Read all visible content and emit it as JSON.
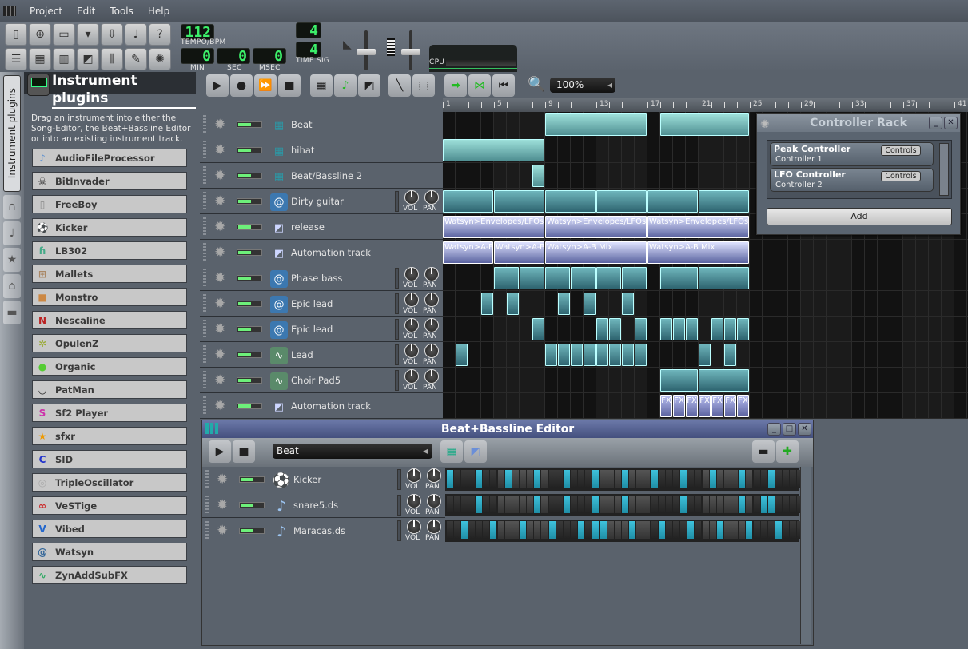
{
  "menu": [
    "Project",
    "Edit",
    "Tools",
    "Help"
  ],
  "toolbar": {
    "row1_icons": [
      "new-project-icon",
      "new-from-template-icon",
      "open-project-icon",
      "recent-projects-icon",
      "save-project-icon",
      "export-icon",
      "whats-this-icon"
    ],
    "row2_icons": [
      "song-editor-icon",
      "beat-bassline-editor-icon",
      "piano-roll-icon",
      "automation-editor-icon",
      "fx-mixer-icon",
      "project-notes-icon",
      "controller-rack-icon"
    ],
    "tempo": {
      "value": "112",
      "label": "TEMPO/BPM"
    },
    "time": {
      "min": "0",
      "sec": "0",
      "msec": "0",
      "min_label": "MIN",
      "sec_label": "SEC",
      "msec_label": "MSEC"
    },
    "time_sig": {
      "numerator": "4",
      "denominator": "4",
      "label": "TIME SIG"
    },
    "cpu_label": "CPU"
  },
  "sidebar": {
    "tabs": [
      "Instrument plugins",
      "My Presets",
      "My Samples",
      "My Favorites",
      "My Home",
      "Root Directory"
    ],
    "title": "Instrument plugins",
    "description": "Drag an instrument into either the Song-Editor, the Beat+Bassline Editor or into an existing instrument track.",
    "plugins": [
      {
        "name": "AudioFileProcessor",
        "glyph": "♪",
        "color": "#5a8fd0"
      },
      {
        "name": "BitInvader",
        "glyph": "☠",
        "color": "#222"
      },
      {
        "name": "FreeBoy",
        "glyph": "▯",
        "color": "#888"
      },
      {
        "name": "Kicker",
        "glyph": "⚽",
        "color": "#c33"
      },
      {
        "name": "LB302",
        "glyph": "ɦ",
        "color": "#4a8"
      },
      {
        "name": "Mallets",
        "glyph": "⊞",
        "color": "#a86"
      },
      {
        "name": "Monstro",
        "glyph": "■",
        "color": "#c84"
      },
      {
        "name": "Nescaline",
        "glyph": "N",
        "color": "#b22"
      },
      {
        "name": "OpulenZ",
        "glyph": "✲",
        "color": "#9a3"
      },
      {
        "name": "Organic",
        "glyph": "●",
        "color": "#5c3"
      },
      {
        "name": "PatMan",
        "glyph": "◡",
        "color": "#222"
      },
      {
        "name": "Sf2 Player",
        "glyph": "S",
        "color": "#c3a"
      },
      {
        "name": "sfxr",
        "glyph": "★",
        "color": "#e90"
      },
      {
        "name": "SID",
        "glyph": "C",
        "color": "#23c"
      },
      {
        "name": "TripleOscillator",
        "glyph": "◎",
        "color": "#aaa"
      },
      {
        "name": "VeSTige",
        "glyph": "∞",
        "color": "#c22"
      },
      {
        "name": "Vibed",
        "glyph": "V",
        "color": "#26c"
      },
      {
        "name": "Watsyn",
        "glyph": "@",
        "color": "#369"
      },
      {
        "name": "ZynAddSubFX",
        "glyph": "∿",
        "color": "#3a6"
      }
    ]
  },
  "song_editor": {
    "zoom": "100%",
    "ruler_labels": [
      "1",
      "5",
      "9",
      "13",
      "17",
      "21",
      "25",
      "29",
      "33",
      "37",
      "41"
    ],
    "knob_labels": {
      "vol": "VOL",
      "pan": "PAN"
    },
    "tracks": [
      {
        "name": "Beat",
        "type": "bb",
        "clips": [
          {
            "start": 8,
            "len": 8,
            "kind": "bbclip"
          },
          {
            "start": 17,
            "len": 7,
            "kind": "bbclip"
          }
        ]
      },
      {
        "name": "hihat",
        "type": "bb",
        "clips": [
          {
            "start": 0,
            "len": 8,
            "kind": "bbclip"
          }
        ]
      },
      {
        "name": "Beat/Bassline 2",
        "type": "bb",
        "clips": [
          {
            "start": 7,
            "len": 1,
            "kind": "bbclip"
          }
        ]
      },
      {
        "name": "Dirty guitar",
        "type": "watsyn",
        "knobs": true,
        "clips": [
          {
            "start": 0,
            "len": 4,
            "kind": "pat"
          },
          {
            "start": 4,
            "len": 4,
            "kind": "pat"
          },
          {
            "start": 8,
            "len": 4,
            "kind": "pat"
          },
          {
            "start": 12,
            "len": 4,
            "kind": "pat"
          },
          {
            "start": 16,
            "len": 4,
            "kind": "pat"
          },
          {
            "start": 20,
            "len": 4,
            "kind": "pat"
          }
        ]
      },
      {
        "name": "release",
        "type": "automation",
        "clips": [
          {
            "start": 0,
            "len": 8,
            "kind": "auto",
            "label": "Watsyn>Envelopes/LFOs>"
          },
          {
            "start": 8,
            "len": 8,
            "kind": "auto",
            "label": "Watsyn>Envelopes/LFOs>"
          },
          {
            "start": 16,
            "len": 8,
            "kind": "auto",
            "label": "Watsyn>Envelopes/LFOs>"
          }
        ]
      },
      {
        "name": "Automation track",
        "type": "automation",
        "clips": [
          {
            "start": 0,
            "len": 4,
            "kind": "auto",
            "label": "Watsyn>A-B Mix"
          },
          {
            "start": 4,
            "len": 4,
            "kind": "auto",
            "label": "Watsyn>A-B Mix"
          },
          {
            "start": 8,
            "len": 8,
            "kind": "auto",
            "label": "Watsyn>A-B Mix"
          },
          {
            "start": 16,
            "len": 8,
            "kind": "auto",
            "label": "Watsyn>A-B Mix"
          }
        ]
      },
      {
        "name": "Phase bass",
        "type": "watsyn",
        "knobs": true,
        "clips": [
          {
            "start": 4,
            "len": 2,
            "kind": "pat"
          },
          {
            "start": 6,
            "len": 2,
            "kind": "pat"
          },
          {
            "start": 8,
            "len": 2,
            "kind": "pat"
          },
          {
            "start": 10,
            "len": 2,
            "kind": "pat"
          },
          {
            "start": 12,
            "len": 2,
            "kind": "pat"
          },
          {
            "start": 14,
            "len": 2,
            "kind": "pat"
          },
          {
            "start": 17,
            "len": 3,
            "kind": "pat"
          },
          {
            "start": 20,
            "len": 4,
            "kind": "pat"
          }
        ]
      },
      {
        "name": "Epic lead",
        "type": "watsyn",
        "knobs": true,
        "clips": [
          {
            "start": 3,
            "len": 1,
            "kind": "pat"
          },
          {
            "start": 5,
            "len": 1,
            "kind": "pat"
          },
          {
            "start": 9,
            "len": 1,
            "kind": "pat"
          },
          {
            "start": 11,
            "len": 1,
            "kind": "pat"
          },
          {
            "start": 14,
            "len": 1,
            "kind": "pat"
          }
        ]
      },
      {
        "name": "Epic lead",
        "type": "watsyn",
        "knobs": true,
        "clips": [
          {
            "start": 7,
            "len": 1,
            "kind": "pat"
          },
          {
            "start": 12,
            "len": 1,
            "kind": "pat"
          },
          {
            "start": 13,
            "len": 1,
            "kind": "pat"
          },
          {
            "start": 15,
            "len": 1,
            "kind": "pat"
          },
          {
            "start": 17,
            "len": 1,
            "kind": "pat"
          },
          {
            "start": 18,
            "len": 1,
            "kind": "pat"
          },
          {
            "start": 19,
            "len": 1,
            "kind": "pat"
          },
          {
            "start": 21,
            "len": 1,
            "kind": "pat"
          },
          {
            "start": 22,
            "len": 1,
            "kind": "pat"
          },
          {
            "start": 23,
            "len": 1,
            "kind": "pat"
          }
        ]
      },
      {
        "name": "Lead",
        "type": "zyn",
        "knobs": true,
        "clips": [
          {
            "start": 1,
            "len": 1,
            "kind": "pat"
          },
          {
            "start": 8,
            "len": 1,
            "kind": "pat"
          },
          {
            "start": 9,
            "len": 1,
            "kind": "pat"
          },
          {
            "start": 10,
            "len": 1,
            "kind": "pat"
          },
          {
            "start": 11,
            "len": 1,
            "kind": "pat"
          },
          {
            "start": 12,
            "len": 1,
            "kind": "pat"
          },
          {
            "start": 13,
            "len": 1,
            "kind": "pat"
          },
          {
            "start": 14,
            "len": 1,
            "kind": "pat"
          },
          {
            "start": 15,
            "len": 1,
            "kind": "pat"
          },
          {
            "start": 20,
            "len": 1,
            "kind": "pat"
          },
          {
            "start": 22,
            "len": 1,
            "kind": "pat"
          }
        ]
      },
      {
        "name": "Choir Pad5",
        "type": "zyn",
        "knobs": true,
        "clips": [
          {
            "start": 17,
            "len": 3,
            "kind": "pat"
          },
          {
            "start": 20,
            "len": 4,
            "kind": "pat"
          }
        ]
      },
      {
        "name": "Automation track",
        "type": "automation",
        "clips": [
          {
            "start": 17,
            "len": 1,
            "kind": "fx",
            "label": "FX"
          },
          {
            "start": 18,
            "len": 1,
            "kind": "fx",
            "label": "FX"
          },
          {
            "start": 19,
            "len": 1,
            "kind": "fx",
            "label": "FX"
          },
          {
            "start": 20,
            "len": 1,
            "kind": "fx",
            "label": "FX"
          },
          {
            "start": 21,
            "len": 1,
            "kind": "fx",
            "label": "FX"
          },
          {
            "start": 22,
            "len": 1,
            "kind": "fx",
            "label": "FX"
          },
          {
            "start": 23,
            "len": 1,
            "kind": "fx",
            "label": "FX"
          }
        ]
      }
    ]
  },
  "controller_rack": {
    "title": "Controller Rack",
    "controllers": [
      {
        "name": "Peak Controller",
        "sub": "Controller 1",
        "button": "Controls"
      },
      {
        "name": "LFO Controller",
        "sub": "Controller 2",
        "button": "Controls"
      }
    ],
    "add_label": "Add"
  },
  "bb_editor": {
    "title": "Beat+Bassline Editor",
    "selected_pattern": "Beat",
    "knob_labels": {
      "vol": "VOL",
      "pan": "PAN"
    },
    "tracks": [
      {
        "name": "Kicker",
        "icon": "kicker",
        "steps": [
          0,
          4,
          8,
          12,
          16,
          20,
          24,
          28,
          32,
          36,
          40,
          44
        ]
      },
      {
        "name": "snare5.ds",
        "icon": "sample",
        "steps": [
          4,
          12,
          16,
          20,
          24,
          32,
          40,
          43,
          44
        ]
      },
      {
        "name": "Maracas.ds",
        "icon": "sample",
        "steps": [
          2,
          6,
          10,
          14,
          18,
          20,
          21,
          25,
          29,
          33,
          37,
          41,
          45
        ]
      }
    ]
  }
}
